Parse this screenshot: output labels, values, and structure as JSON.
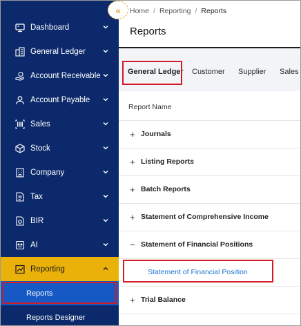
{
  "sidebar": {
    "items": [
      {
        "label": "Dashboard",
        "icon": "monitor-icon"
      },
      {
        "label": "General Ledger",
        "icon": "ledger-icon"
      },
      {
        "label": "Account Receivable",
        "icon": "coin-hand-icon"
      },
      {
        "label": "Account Payable",
        "icon": "person-icon"
      },
      {
        "label": "Sales",
        "icon": "barcode-icon"
      },
      {
        "label": "Stock",
        "icon": "box-icon"
      },
      {
        "label": "Company",
        "icon": "building-icon"
      },
      {
        "label": "Tax",
        "icon": "tax-document-icon"
      },
      {
        "label": "BIR",
        "icon": "bir-document-icon"
      },
      {
        "label": "AI",
        "icon": "ai-icon"
      },
      {
        "label": "Reporting",
        "icon": "chart-icon"
      }
    ],
    "sub_items": [
      {
        "label": "Reports"
      },
      {
        "label": "Reports Designer"
      }
    ],
    "active_color": "#eab10a",
    "bg_color": "#0c2a6b"
  },
  "breadcrumb": {
    "items": [
      "Home",
      "Reporting",
      "Reports"
    ],
    "separator": "/"
  },
  "page": {
    "title": "Reports"
  },
  "tabs": [
    {
      "label": "General Ledger",
      "active": true
    },
    {
      "label": "Customer"
    },
    {
      "label": "Supplier"
    },
    {
      "label": "Sales"
    }
  ],
  "table": {
    "column_header": "Report Name",
    "groups": [
      {
        "toggle": "+",
        "label": "Journals"
      },
      {
        "toggle": "+",
        "label": "Listing Reports"
      },
      {
        "toggle": "+",
        "label": "Batch Reports"
      },
      {
        "toggle": "+",
        "label": "Statement of Comprehensive Income"
      },
      {
        "toggle": "−",
        "label": "Statement of Financial Positions",
        "expanded": true,
        "children": [
          {
            "label": "Statement of Financial Position"
          }
        ]
      },
      {
        "toggle": "+",
        "label": "Trial Balance"
      }
    ]
  },
  "colors": {
    "link": "#1f73d1",
    "highlight_box": "#d21b24"
  }
}
